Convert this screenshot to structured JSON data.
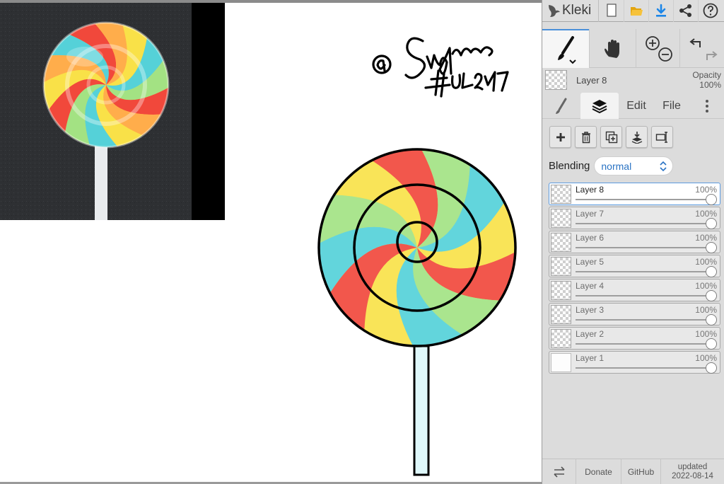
{
  "app": {
    "name": "Kleki"
  },
  "toolbar": {
    "icons": [
      "kleki-logo-icon",
      "new-file-icon",
      "open-folder-icon",
      "download-icon",
      "share-icon",
      "help-icon"
    ],
    "accent_color": "#1c86e8",
    "folder_color": "#f2b51c"
  },
  "tools": {
    "active": "brush",
    "icons": [
      "brush-icon",
      "hand-icon",
      "zoom-in-icon",
      "zoom-out-icon",
      "undo-icon",
      "redo-icon"
    ]
  },
  "current_layer": {
    "name": "Layer 8",
    "opacity_label": "Opacity",
    "opacity_value": "100%"
  },
  "tabs": [
    {
      "id": "brush",
      "label": ""
    },
    {
      "id": "layers",
      "label": ""
    },
    {
      "id": "edit",
      "label": "Edit"
    },
    {
      "id": "file",
      "label": "File"
    },
    {
      "id": "more",
      "label": ""
    }
  ],
  "active_tab": "layers",
  "layer_actions": [
    "add-layer-icon",
    "delete-layer-icon",
    "duplicate-layer-icon",
    "merge-down-icon",
    "rename-layer-icon"
  ],
  "blending": {
    "label": "Blending",
    "value": "normal"
  },
  "layers": [
    {
      "name": "Layer 8",
      "opacity": "100%",
      "selected": true
    },
    {
      "name": "Layer 7",
      "opacity": "100%",
      "selected": false
    },
    {
      "name": "Layer 6",
      "opacity": "100%",
      "selected": false
    },
    {
      "name": "Layer 5",
      "opacity": "100%",
      "selected": false
    },
    {
      "name": "Layer 4",
      "opacity": "100%",
      "selected": false
    },
    {
      "name": "Layer 3",
      "opacity": "100%",
      "selected": false
    },
    {
      "name": "Layer 2",
      "opacity": "100%",
      "selected": false
    },
    {
      "name": "Layer 1",
      "opacity": "100%",
      "selected": false
    }
  ],
  "footer": {
    "donate": "Donate",
    "github": "GitHub",
    "updated_label": "updated",
    "updated_date": "2022-08-14"
  },
  "canvas": {
    "signature_text": "@ Singh… #UA247",
    "stick_color": "#dff8fb",
    "candy_colors": [
      "#f03c3c",
      "#46d0e6",
      "#f8e24a",
      "#9be38a",
      "#ffa94d"
    ]
  }
}
